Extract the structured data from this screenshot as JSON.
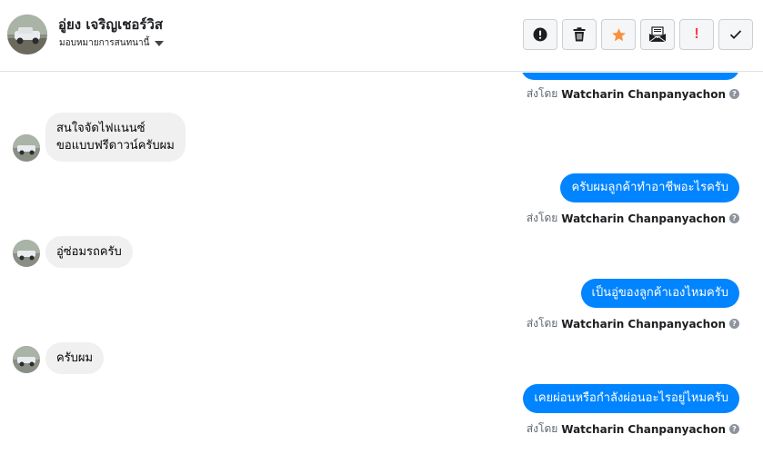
{
  "header": {
    "name": "อู่ยง เจริญเชอร์วิส",
    "subtitle": "มอบหมายการสนทนานี้"
  },
  "toolbar": {
    "buttons": [
      {
        "name": "report-button",
        "icon": "alert-circle-icon",
        "glyph": "!"
      },
      {
        "name": "delete-button",
        "icon": "trash-icon"
      },
      {
        "name": "star-button",
        "icon": "star-icon",
        "color": "#f7923b"
      },
      {
        "name": "mark-unread-button",
        "icon": "envelope-icon"
      },
      {
        "name": "spam-button",
        "icon": "exclamation-icon",
        "glyph": "!",
        "color": "#fa3e3e"
      },
      {
        "name": "done-button",
        "icon": "check-icon",
        "glyph": "✓"
      }
    ]
  },
  "sent_by": {
    "prefix": "ส่งโดย",
    "name": "Watcharin Chanpanyachon",
    "help": "?"
  },
  "messages": [
    {
      "direction": "in",
      "text": "สนใจจัดไฟแนนซ์",
      "text2": "ขอแบบฟรีดาวน์ครับผม"
    },
    {
      "direction": "out",
      "text": "ครับผมลูกค้าทำอาชีพอะไรครับ"
    },
    {
      "direction": "in",
      "text": "อู่ซ่อมรถครับ"
    },
    {
      "direction": "out",
      "text": "เป็นอู่ของลูกค้าเองไหมครับ"
    },
    {
      "direction": "in",
      "text": "ครับผม"
    },
    {
      "direction": "out",
      "text": "เคยผ่อนหรือกำลังผ่อนอะไรอยู่ไหมครับ"
    }
  ],
  "colors": {
    "outgoing_bubble": "#0084ff",
    "incoming_bubble": "#f0f0f0"
  }
}
